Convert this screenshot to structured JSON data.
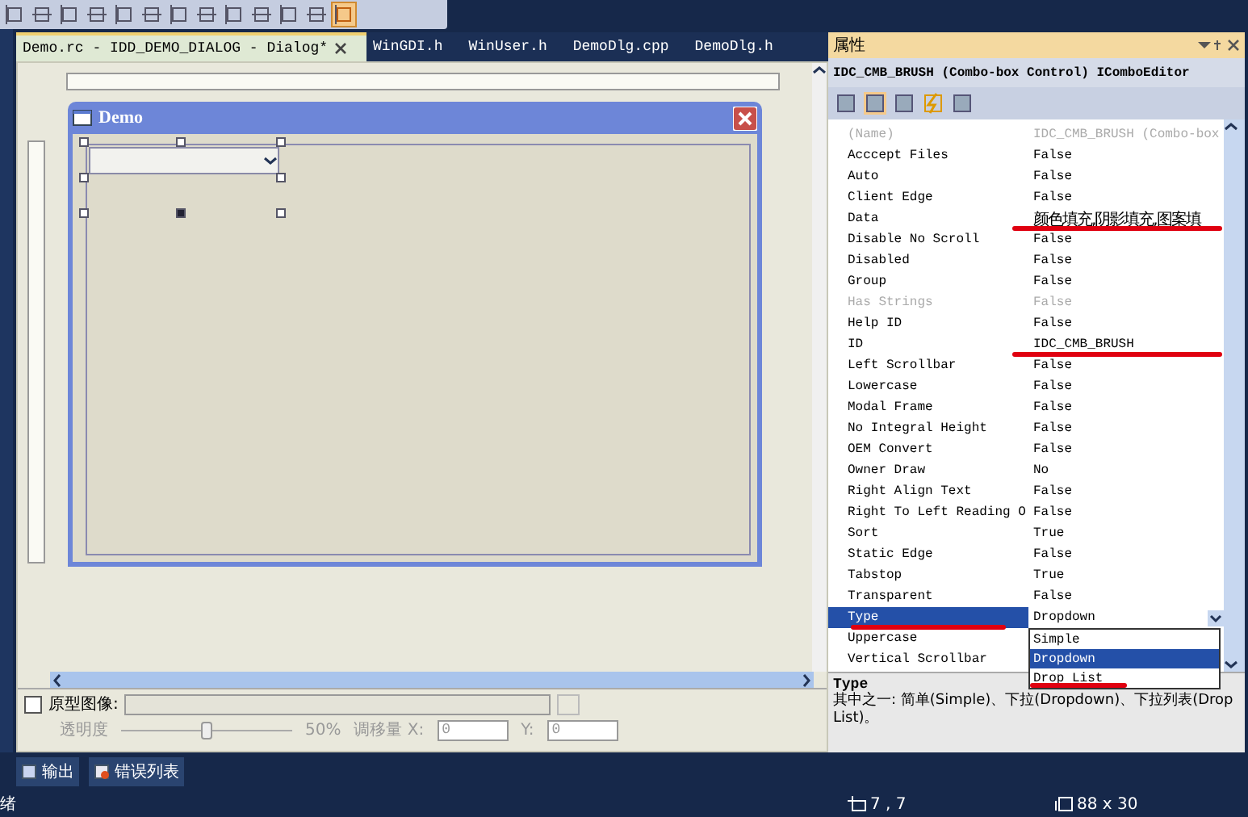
{
  "tabs": [
    {
      "label": "Demo.rc - IDD_DEMO_DIALOG - Dialog*",
      "selected": true
    },
    {
      "label": "WinGDI.h",
      "selected": false
    },
    {
      "label": "WinUser.h",
      "selected": false
    },
    {
      "label": "DemoDlg.cpp",
      "selected": false
    },
    {
      "label": "DemoDlg.h",
      "selected": false
    }
  ],
  "dialog": {
    "title": "Demo"
  },
  "bottom_panel": {
    "checkbox": {
      "label": "原型图像:",
      "checked": false
    },
    "opacity_label": "透明度",
    "opacity": {
      "level": 0.5
    },
    "opacity_reading": "50%",
    "offset_label": "调移量 X:",
    "x_value": "0",
    "y_label": "Y:",
    "y_value": "0"
  },
  "output_tabs": [
    {
      "label": "输出"
    },
    {
      "label": "错误列表"
    }
  ],
  "status_bar": {
    "text": "绪",
    "position": "7 , 7",
    "size": "88 x 30"
  },
  "properties": {
    "title": "属性",
    "object": "IDC_CMB_BRUSH (Combo-box Control) IComboEditor",
    "rows": [
      {
        "name": "(Name)",
        "value": "IDC_CMB_BRUSH (Combo-box",
        "disabled": true,
        "selected": false,
        "marked": false
      },
      {
        "name": "Acccept Files",
        "value": "False",
        "disabled": false,
        "selected": false,
        "marked": false
      },
      {
        "name": "Auto",
        "value": "False",
        "disabled": false,
        "selected": false,
        "marked": false
      },
      {
        "name": "Client Edge",
        "value": "False",
        "disabled": false,
        "selected": false,
        "marked": false
      },
      {
        "name": "Data",
        "value": "颜色填充,阴影填充,图案填",
        "disabled": false,
        "selected": false,
        "marked": true
      },
      {
        "name": "Disable No Scroll",
        "value": "False",
        "disabled": false,
        "selected": false,
        "marked": false
      },
      {
        "name": "Disabled",
        "value": "False",
        "disabled": false,
        "selected": false,
        "marked": false
      },
      {
        "name": "Group",
        "value": "False",
        "disabled": false,
        "selected": false,
        "marked": false
      },
      {
        "name": "Has Strings",
        "value": "False",
        "disabled": true,
        "selected": false,
        "marked": false
      },
      {
        "name": "Help ID",
        "value": "False",
        "disabled": false,
        "selected": false,
        "marked": false
      },
      {
        "name": "ID",
        "value": "IDC_CMB_BRUSH",
        "disabled": false,
        "selected": false,
        "marked": true
      },
      {
        "name": "Left Scrollbar",
        "value": "False",
        "disabled": false,
        "selected": false,
        "marked": false
      },
      {
        "name": "Lowercase",
        "value": "False",
        "disabled": false,
        "selected": false,
        "marked": false
      },
      {
        "name": "Modal Frame",
        "value": "False",
        "disabled": false,
        "selected": false,
        "marked": false
      },
      {
        "name": "No Integral Height",
        "value": "False",
        "disabled": false,
        "selected": false,
        "marked": false
      },
      {
        "name": "OEM Convert",
        "value": "False",
        "disabled": false,
        "selected": false,
        "marked": false
      },
      {
        "name": "Owner Draw",
        "value": "No",
        "disabled": false,
        "selected": false,
        "marked": false
      },
      {
        "name": "Right Align Text",
        "value": "False",
        "disabled": false,
        "selected": false,
        "marked": false
      },
      {
        "name": "Right To Left Reading O",
        "value": "False",
        "disabled": false,
        "selected": false,
        "marked": false
      },
      {
        "name": "Sort",
        "value": "True",
        "disabled": false,
        "selected": false,
        "marked": false
      },
      {
        "name": "Static Edge",
        "value": "False",
        "disabled": false,
        "selected": false,
        "marked": false
      },
      {
        "name": "Tabstop",
        "value": "True",
        "disabled": false,
        "selected": false,
        "marked": false
      },
      {
        "name": "Transparent",
        "value": "False",
        "disabled": false,
        "selected": false,
        "marked": false
      },
      {
        "name": "Type",
        "value": "Dropdown",
        "disabled": false,
        "selected": true,
        "marked": true
      },
      {
        "name": "Uppercase",
        "value": "",
        "disabled": false,
        "selected": false,
        "marked": false
      },
      {
        "name": "Vertical Scrollbar",
        "value": "",
        "disabled": false,
        "selected": false,
        "marked": false
      }
    ],
    "dropdown": {
      "options": [
        {
          "label": "Simple",
          "selected": false,
          "marked": false
        },
        {
          "label": "Dropdown",
          "selected": true,
          "marked": false
        },
        {
          "label": "Drop List",
          "selected": false,
          "marked": true
        }
      ]
    },
    "description": {
      "title": "Type",
      "text": "其中之一: 简单(Simple)、下拉(Dropdown)、下拉列表(Drop List)。"
    }
  }
}
